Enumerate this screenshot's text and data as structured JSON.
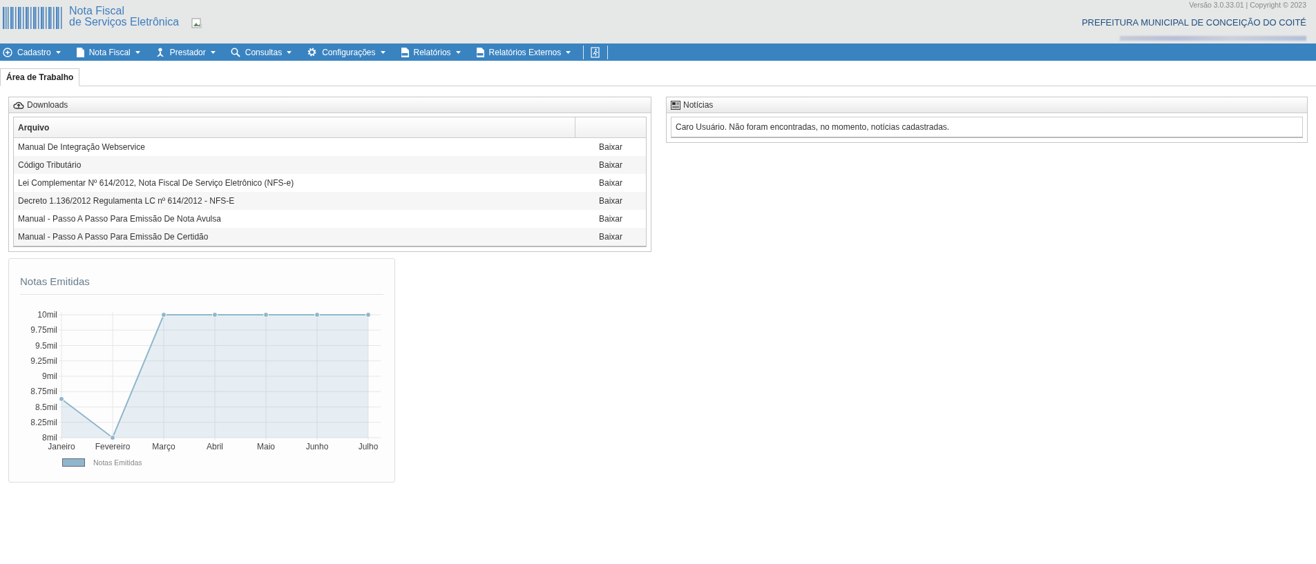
{
  "header": {
    "logo_line1": "Nota Fiscal",
    "logo_line2": "de Serviços Eletrônica",
    "version": "Versão 3.0.33.01 | Copyright © 2023",
    "municipality": "PREFEITURA MUNICIPAL DE CONCEIÇÃO DO COITÉ"
  },
  "menu": [
    {
      "label": "Cadastro"
    },
    {
      "label": "Nota Fiscal"
    },
    {
      "label": "Prestador"
    },
    {
      "label": "Consultas"
    },
    {
      "label": "Configurações"
    },
    {
      "label": "Relatórios"
    },
    {
      "label": "Relatórios Externos"
    }
  ],
  "tabs": [
    {
      "label": "Área de Trabalho",
      "selected": true
    }
  ],
  "downloads": {
    "title": "Downloads",
    "columns": [
      "Arquivo"
    ],
    "rows": [
      {
        "name": "Manual De Integração Webservice",
        "action": "Baixar"
      },
      {
        "name": "Código Tributário",
        "action": "Baixar"
      },
      {
        "name": "Lei Complementar Nº 614/2012, Nota Fiscal De Serviço Eletrônico (NFS-e)",
        "action": "Baixar"
      },
      {
        "name": "Decreto 1.136/2012 Regulamenta LC nº 614/2012 - NFS-E",
        "action": "Baixar"
      },
      {
        "name": "Manual - Passo A Passo Para Emissão De Nota Avulsa",
        "action": "Baixar"
      },
      {
        "name": "Manual - Passo A Passo Para Emissão De Certidão",
        "action": "Baixar"
      }
    ]
  },
  "news": {
    "title": "Notícias",
    "message": "Caro Usuário. Não foram encontradas, no momento, notícias cadastradas."
  },
  "chart": {
    "title": "Notas Emitidas",
    "chart_data": {
      "type": "area",
      "categories": [
        "Janeiro",
        "Fevereiro",
        "Março",
        "Abril",
        "Maio",
        "Junho",
        "Julho"
      ],
      "series": [
        {
          "name": "Notas Emitidas",
          "color": "#8fb6cc",
          "values": [
            8.63,
            8,
            10,
            10,
            10,
            10,
            10
          ]
        }
      ],
      "ylim": [
        8,
        10
      ],
      "grid": true,
      "yticks": [
        {
          "value": 8,
          "label": "8mil"
        },
        {
          "value": 8.25,
          "label": "8.25mil"
        },
        {
          "value": 8.5,
          "label": "8.5mil"
        },
        {
          "value": 8.75,
          "label": "8.75mil"
        },
        {
          "value": 9,
          "label": "9mil"
        },
        {
          "value": 9.25,
          "label": "9.25mil"
        },
        {
          "value": 9.5,
          "label": "9.5mil"
        },
        {
          "value": 9.75,
          "label": "9.75mil"
        },
        {
          "value": 10,
          "label": "10mil"
        }
      ]
    }
  }
}
